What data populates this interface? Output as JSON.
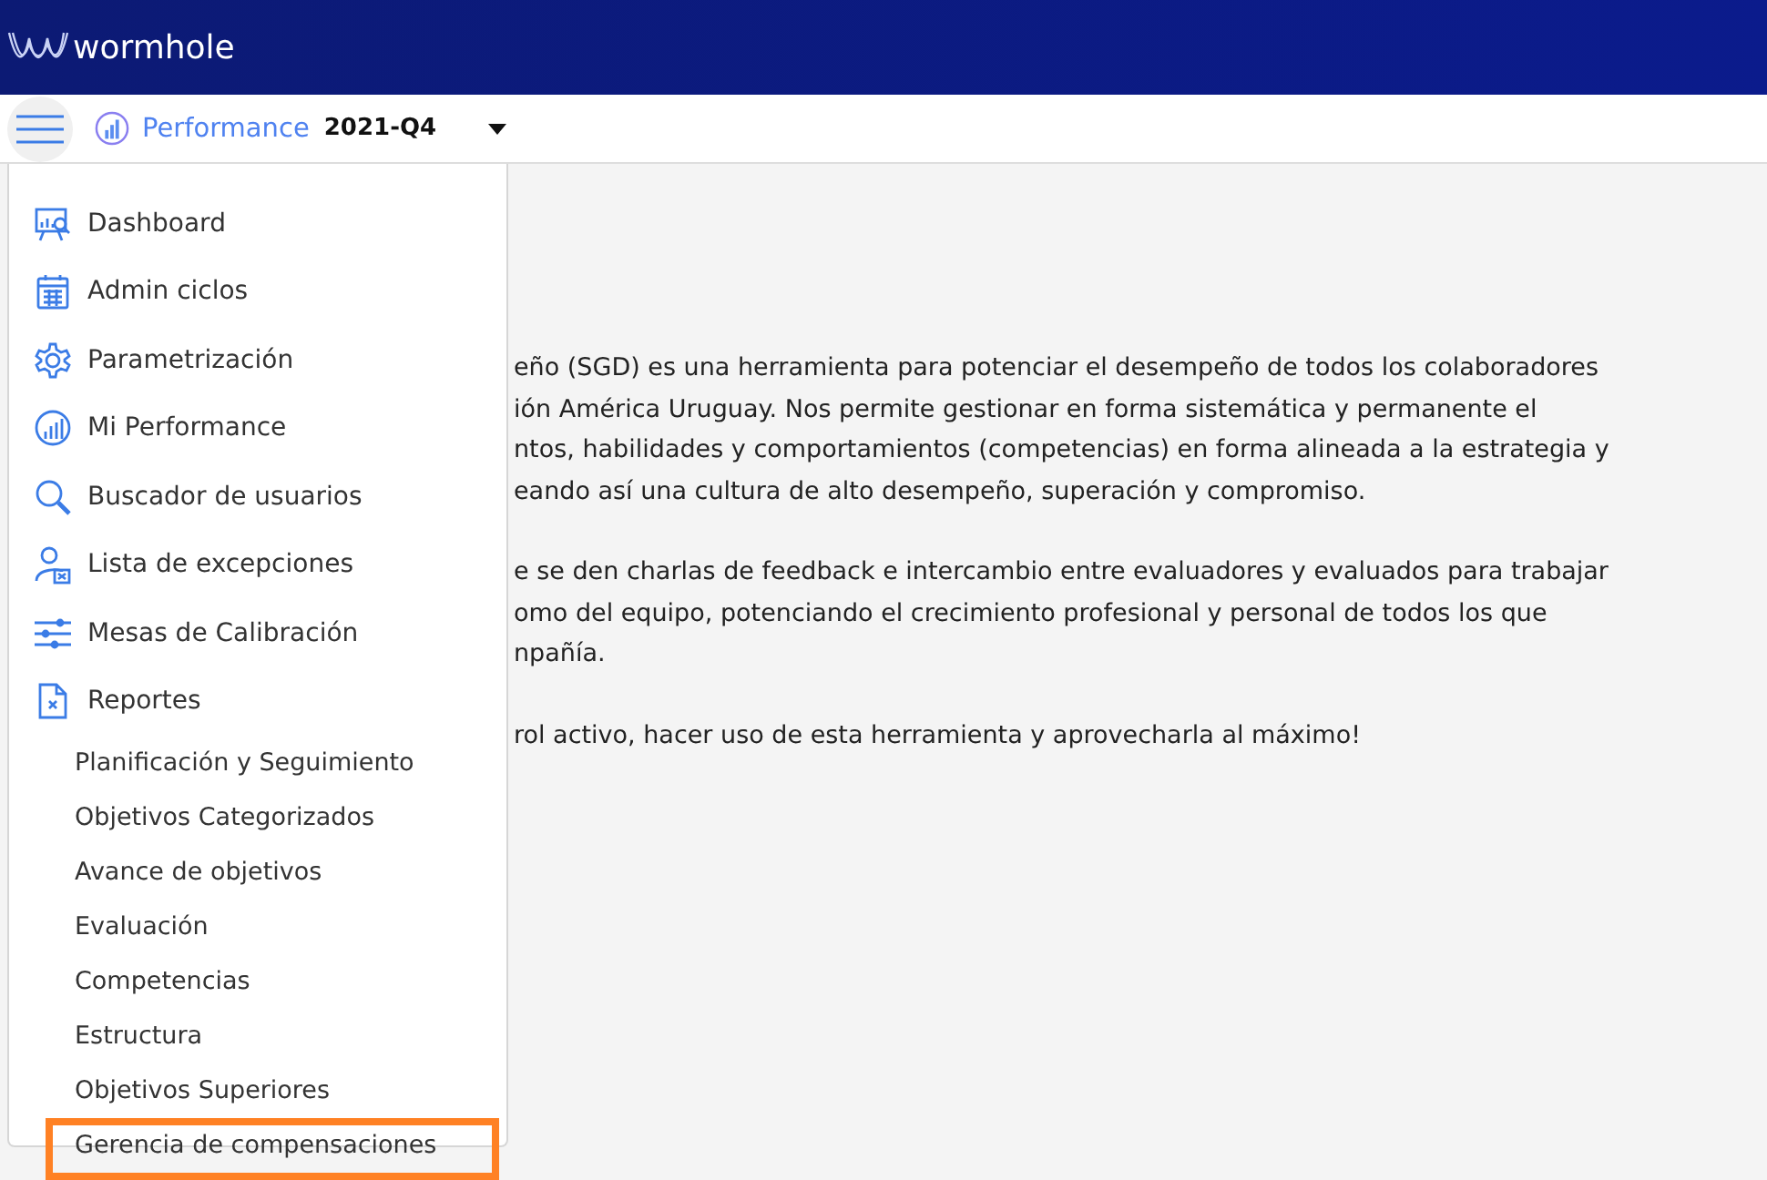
{
  "header": {
    "brand": "wormhole"
  },
  "toolbar": {
    "module": "Performance",
    "period": "2021-Q4"
  },
  "menu": {
    "items": [
      {
        "label": "Dashboard"
      },
      {
        "label": "Admin ciclos"
      },
      {
        "label": "Parametrización"
      },
      {
        "label": "Mi Performance"
      },
      {
        "label": "Buscador de usuarios"
      },
      {
        "label": "Lista de excepciones"
      },
      {
        "label": "Mesas de Calibración"
      },
      {
        "label": "Reportes",
        "children": [
          {
            "label": "Planificación y Seguimiento",
            "highlighted": false
          },
          {
            "label": "Objetivos Categorizados",
            "highlighted": false
          },
          {
            "label": "Avance de objetivos",
            "highlighted": false
          },
          {
            "label": "Evaluación",
            "highlighted": false
          },
          {
            "label": "Competencias",
            "highlighted": false
          },
          {
            "label": "Estructura",
            "highlighted": false
          },
          {
            "label": "Objetivos Superiores",
            "highlighted": false
          },
          {
            "label": "Gerencia de compensaciones",
            "highlighted": true
          }
        ]
      }
    ]
  },
  "content": {
    "paragraphs": [
      [
        "eño (SGD) es una herramienta para potenciar el desempeño de todos los colaboradores",
        "ión América Uruguay. Nos permite gestionar en forma sistemática y permanente el",
        "ntos, habilidades y comportamientos (competencias) en forma alineada a la estrategia y",
        "eando así una cultura de alto desempeño, superación y compromiso."
      ],
      [
        "e se den charlas de feedback e intercambio entre evaluadores y evaluados para trabajar",
        "omo del equipo, potenciando el crecimiento profesional y personal de todos los que",
        "npañía."
      ],
      [
        "rol activo, hacer uso de esta herramienta y aprovecharla al máximo!"
      ]
    ]
  }
}
